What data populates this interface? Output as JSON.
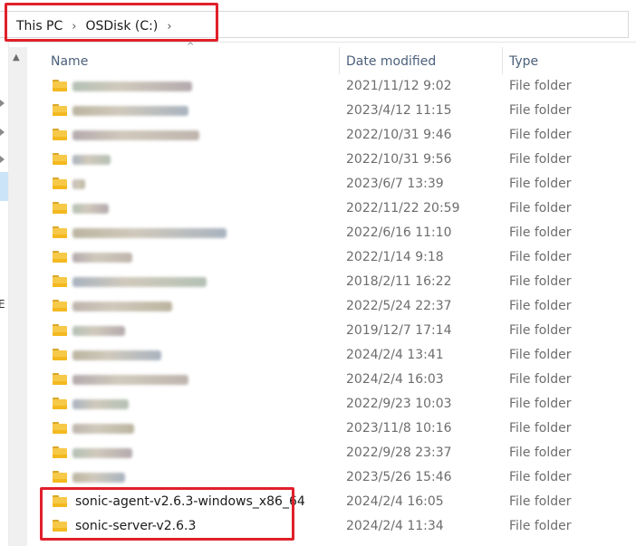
{
  "breadcrumb": {
    "items": [
      "This PC",
      "OSDisk (C:)"
    ],
    "separator": "›"
  },
  "columns": {
    "name": "Name",
    "date_modified": "Date modified",
    "type": "Type"
  },
  "rows": [
    {
      "name": "",
      "date": "2021/11/12 9:02",
      "type": "File folder",
      "blurred": true
    },
    {
      "name": "",
      "date": "2023/4/12 11:15",
      "type": "File folder",
      "blurred": true
    },
    {
      "name": "",
      "date": "2022/10/31 9:46",
      "type": "File folder",
      "blurred": true
    },
    {
      "name": "",
      "date": "2022/10/31 9:56",
      "type": "File folder",
      "blurred": true
    },
    {
      "name": "",
      "date": "2023/6/7 13:39",
      "type": "File folder",
      "blurred": true
    },
    {
      "name": "",
      "date": "2022/11/22 20:59",
      "type": "File folder",
      "blurred": true
    },
    {
      "name": "",
      "date": "2022/6/16 11:10",
      "type": "File folder",
      "blurred": true
    },
    {
      "name": "",
      "date": "2022/1/14 9:18",
      "type": "File folder",
      "blurred": true
    },
    {
      "name": "",
      "date": "2018/2/11 16:22",
      "type": "File folder",
      "blurred": true
    },
    {
      "name": "",
      "date": "2022/5/24 22:37",
      "type": "File folder",
      "blurred": true
    },
    {
      "name": "",
      "date": "2019/12/7 17:14",
      "type": "File folder",
      "blurred": true
    },
    {
      "name": "",
      "date": "2024/2/4 13:41",
      "type": "File folder",
      "blurred": true
    },
    {
      "name": "",
      "date": "2024/2/4 16:03",
      "type": "File folder",
      "blurred": true
    },
    {
      "name": "",
      "date": "2022/9/23 10:03",
      "type": "File folder",
      "blurred": true
    },
    {
      "name": "",
      "date": "2023/11/8 10:16",
      "type": "File folder",
      "blurred": true
    },
    {
      "name": "",
      "date": "2022/9/28 23:37",
      "type": "File folder",
      "blurred": true
    },
    {
      "name": "",
      "date": "2023/5/26 15:46",
      "type": "File folder",
      "blurred": true
    },
    {
      "name": "sonic-agent-v2.6.3-windows_x86_64",
      "date": "2024/2/4 16:05",
      "type": "File folder",
      "blurred": false
    },
    {
      "name": "sonic-server-v2.6.3",
      "date": "2024/2/4 11:34",
      "type": "File folder",
      "blurred": false
    }
  ],
  "icons": {
    "folder": "folder-icon",
    "sort": "sort-up-icon",
    "chevron": "chevron-right-icon"
  },
  "colors": {
    "highlight": "#e0202a",
    "folder": "#f7c948",
    "header_text": "#4c607a",
    "secondary_text": "#6d6d6d"
  }
}
